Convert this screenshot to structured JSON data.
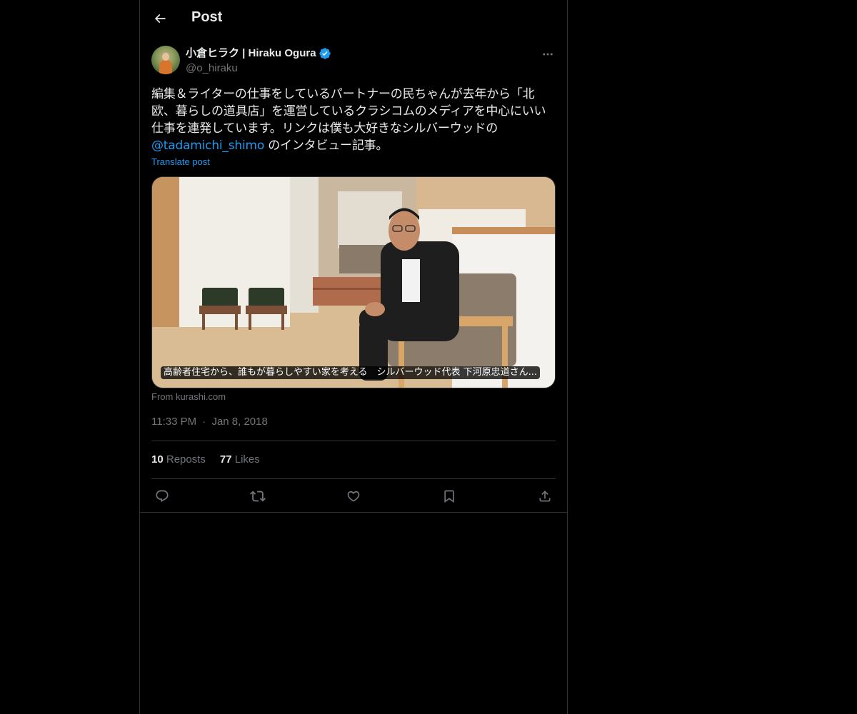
{
  "header": {
    "title": "Post",
    "back_icon": "arrow-left-icon"
  },
  "post": {
    "author_name": "小倉ヒラク | Hiraku Ogura",
    "handle": "@o_hiraku",
    "verified": true,
    "text_before_mention": "編集＆ライターの仕事をしているパートナーの民ちゃんが去年から「北欧、暮らしの道具店」を運営しているクラシコムのメディアを中心にいい仕事を連発しています。リンクは僕も大好きなシルバーウッドの",
    "mention": "@tadamichi_shimo",
    "text_after_mention": " のインタビュー記事。",
    "translate_label": "Translate post",
    "media_caption": "高齢者住宅から、誰もが暮らしやすい家を考える　シルバーウッド代表 下河原忠道さん...",
    "source": "From kurashi.com",
    "time": "11:33 PM",
    "date": "Jan 8, 2018",
    "time_separator": "·"
  },
  "stats": {
    "reposts_count": "10",
    "reposts_label": "Reposts",
    "likes_count": "77",
    "likes_label": "Likes"
  },
  "actions": [
    "reply-icon",
    "repost-icon",
    "like-icon",
    "bookmark-icon",
    "share-icon"
  ],
  "colors": {
    "background": "#000000",
    "text": "#e7e9ea",
    "secondary": "#71767b",
    "accent": "#1d9bf0",
    "border": "#2f3336"
  }
}
